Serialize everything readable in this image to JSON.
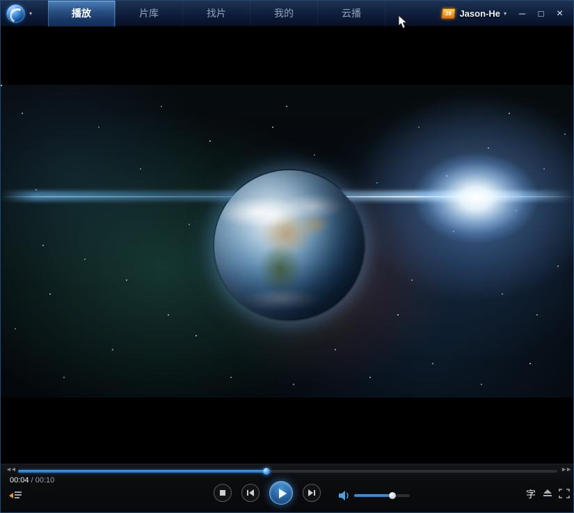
{
  "titlebar": {
    "tabs": [
      {
        "label": "播放",
        "active": true
      },
      {
        "label": "片库",
        "active": false
      },
      {
        "label": "找片",
        "active": false
      },
      {
        "label": "我的",
        "active": false
      },
      {
        "label": "云播",
        "active": false
      }
    ],
    "user": {
      "name": "Jason-He",
      "badge_text": "28"
    },
    "icons": {
      "logo_caret": "▾",
      "user_caret": "▾",
      "minimize": "─",
      "maximize": "□",
      "close": "×"
    }
  },
  "player": {
    "time_current": "00:04",
    "time_separator": " / ",
    "time_total": "00:10",
    "progress_percent": 46,
    "volume_percent": 70,
    "subtitle_label": "字",
    "icons": {
      "rewind": "◄◄",
      "fast_forward": "►►"
    }
  },
  "colors": {
    "accent_blue": "#2f8fe0",
    "titlebar_navy": "#122140",
    "badge_orange": "#f59a23",
    "progress_fill": "#1a6fc2"
  }
}
